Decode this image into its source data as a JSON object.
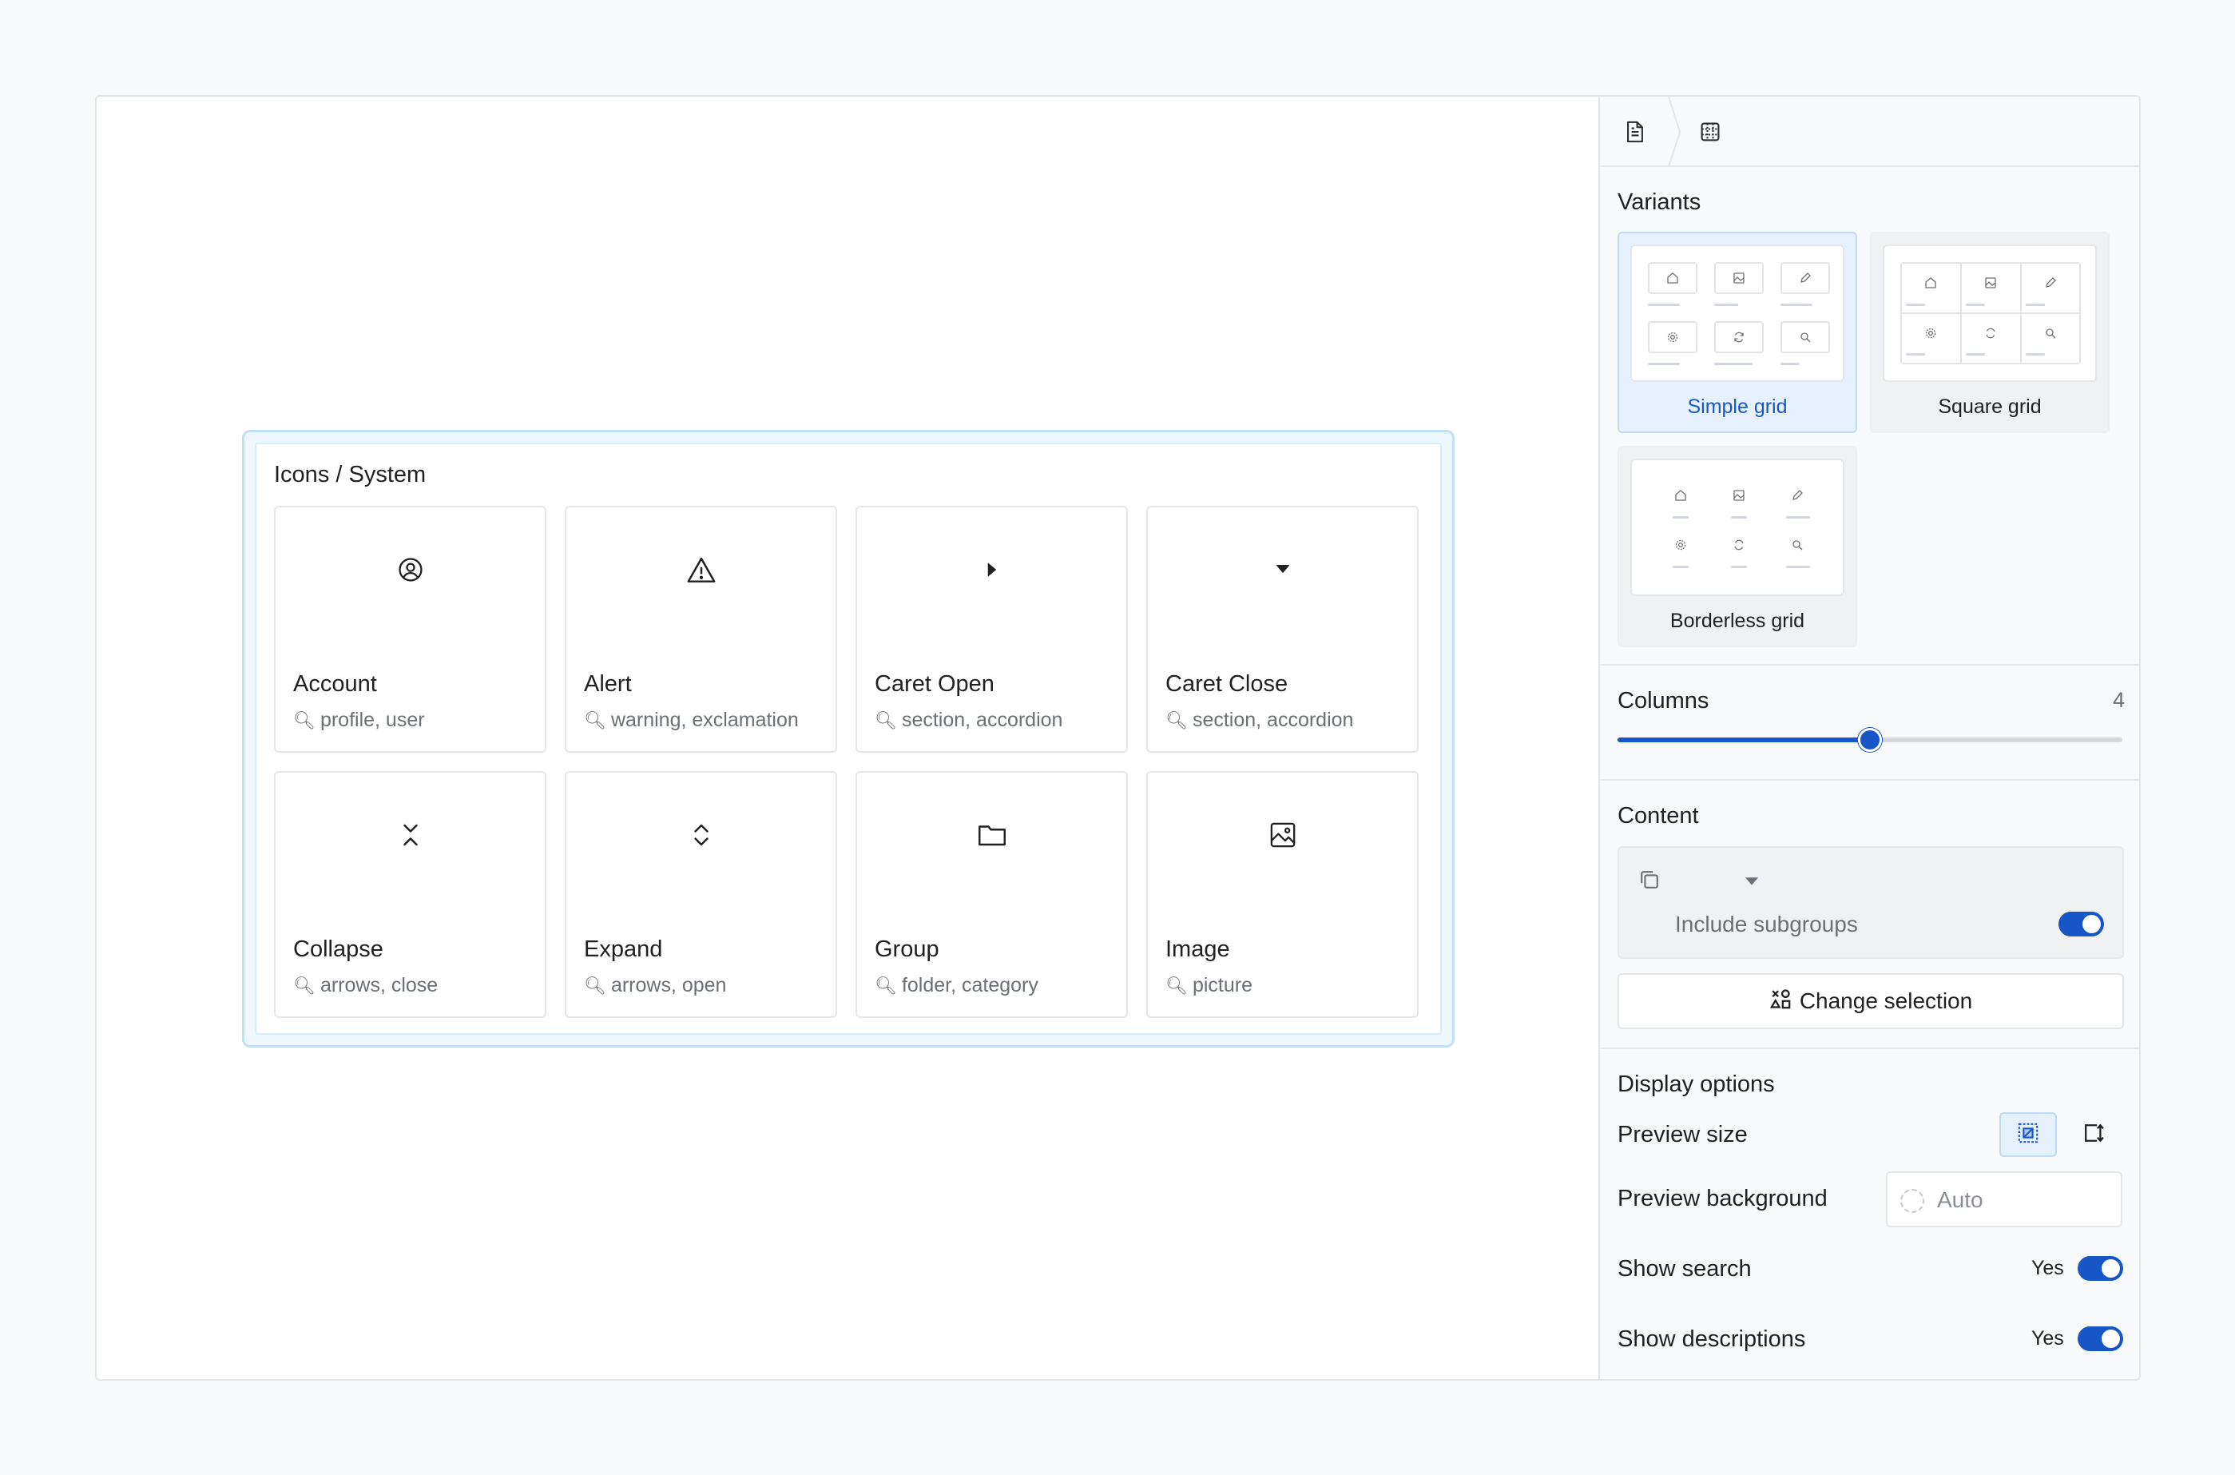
{
  "block": {
    "title": "Icons / System",
    "tiles": [
      {
        "icon": "account-circle-icon",
        "name": "Account",
        "desc": "profile, user"
      },
      {
        "icon": "alert-triangle-icon",
        "name": "Alert",
        "desc": "warning, exclamation"
      },
      {
        "icon": "caret-right-icon",
        "name": "Caret Open",
        "desc": "section, accordion"
      },
      {
        "icon": "caret-down-icon",
        "name": "Caret Close",
        "desc": "section, accordion"
      },
      {
        "icon": "collapse-icon",
        "name": "Collapse",
        "desc": "arrows, close"
      },
      {
        "icon": "expand-icon",
        "name": "Expand",
        "desc": "arrows, open"
      },
      {
        "icon": "folder-icon",
        "name": "Group",
        "desc": "folder, category"
      },
      {
        "icon": "image-icon",
        "name": "Image",
        "desc": "picture"
      }
    ]
  },
  "panel": {
    "variants_label": "Variants",
    "variants": [
      {
        "label": "Simple grid",
        "selected": true
      },
      {
        "label": "Square grid",
        "selected": false
      },
      {
        "label": "Borderless grid",
        "selected": false
      }
    ],
    "columns_label": "Columns",
    "columns_value": "4",
    "columns_slider_fraction": 0.5,
    "content_label": "Content",
    "include_subgroups_label": "Include subgroups",
    "include_subgroups": true,
    "change_selection_label": "Change selection",
    "display_options_label": "Display options",
    "preview_size_label": "Preview size",
    "preview_background_label": "Preview background",
    "preview_background_value": "Auto",
    "show_search_label": "Show search",
    "show_search_value": "Yes",
    "show_descriptions_label": "Show descriptions",
    "show_descriptions_value": "Yes"
  },
  "colors": {
    "accent": "#1756c7",
    "selected_bg": "#e7f1fd"
  }
}
